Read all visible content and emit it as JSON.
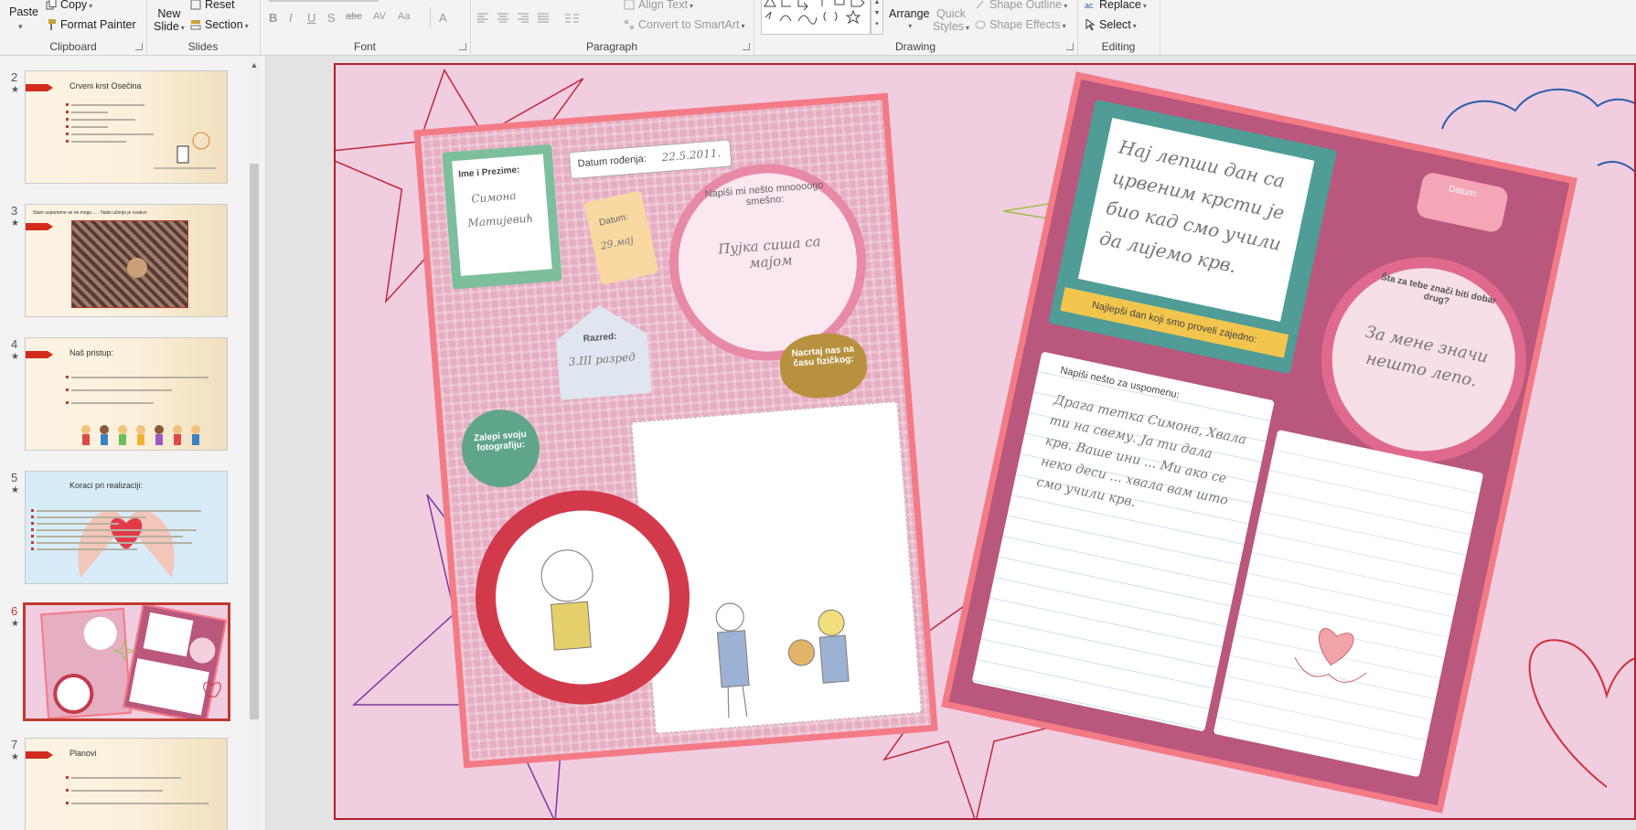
{
  "ribbon": {
    "clipboard": {
      "paste": "Paste",
      "copy": "Copy",
      "format_painter": "Format Painter",
      "label": "Clipboard"
    },
    "slides": {
      "new_slide_1": "New",
      "new_slide_2": "Slide",
      "reset": "Reset",
      "section": "Section",
      "label": "Slides"
    },
    "font": {
      "bold": "B",
      "italic": "I",
      "underline": "U",
      "shadow": "S",
      "strike": "abc",
      "spacing": "AV",
      "case": "Aa",
      "color": "A",
      "label": "Font"
    },
    "paragraph": {
      "align_text": "Align Text",
      "smartart": "Convert to SmartArt",
      "label": "Paragraph"
    },
    "drawing": {
      "arrange": "Arrange",
      "quick_styles_1": "Quick",
      "quick_styles_2": "Styles",
      "shape_outline": "Shape Outline",
      "shape_effects": "Shape Effects",
      "label": "Drawing"
    },
    "editing": {
      "replace": "Replace",
      "select": "Select",
      "label": "Editing"
    }
  },
  "thumbnails": [
    {
      "num": "2",
      "title": "Crveni krst Osečina"
    },
    {
      "num": "3",
      "title": "Stare uspomene se ne mogu ... - Naše učenje je ovakvo"
    },
    {
      "num": "4",
      "title": "Naš pristup:"
    },
    {
      "num": "5",
      "title": "Koraci pri realizaciji:"
    },
    {
      "num": "6",
      "title": ""
    },
    {
      "num": "7",
      "title": "Planovi"
    }
  ],
  "slide": {
    "left_photo": {
      "name_label": "Ime i Prezime:",
      "name_value_1": "Симона",
      "name_value_2": "Матијевић",
      "birth_label": "Datum rođenja:",
      "birth_value": "22.5.2011.",
      "date_label": "Datum:",
      "date_value": "29.мај",
      "funny_label": "Napiši mi nešto mnoooogo smešno:",
      "funny_value": "Пујка сиша са мајом",
      "grade_label": "Razred:",
      "grade_value": "3.III разред",
      "photo_label": "Zalepi svoju fotografiju:",
      "draw_label": "Nacrtaj nas na času fizičkog:"
    },
    "right_photo": {
      "best_day_text": "Нај лепши дан са црвеним крсти је био кад смо учили да лијемо крв.",
      "best_day_label": "Najlepši dan koji smo proveli zajedno:",
      "date_label": "Datum:",
      "friend_label": "Šta za tebe znači biti dobar drug?",
      "friend_value": "За мене значи нешто лепо.",
      "memory_label": "Napiši nešto za uspomenu:",
      "memory_text": "Драга тетка Симона, Хвала ти на свему. Ја ти дала крв. Ваше ини ... Ми ако се неко деси ... хвала вам што смо учили крв."
    }
  },
  "colors": {
    "accent": "#b7472a",
    "slide_bg": "#f1cde0",
    "photo_border": "#f37b86",
    "selection": "#c0392b"
  }
}
